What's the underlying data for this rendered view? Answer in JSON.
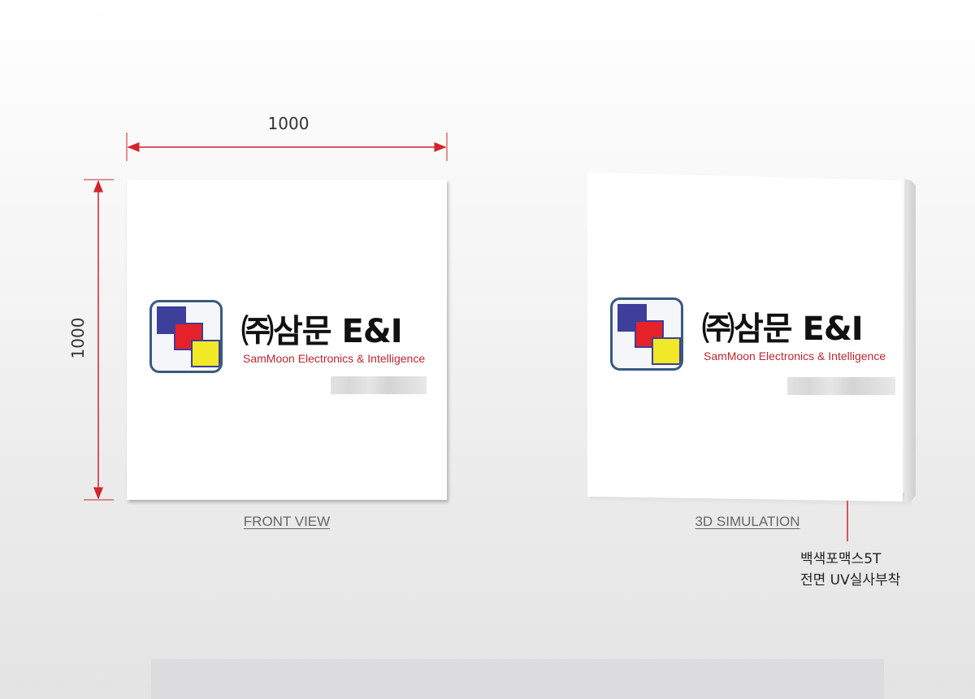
{
  "dimensions": {
    "width_label": "1000",
    "height_label": "1000"
  },
  "logo": {
    "title": "㈜삼문 E&I",
    "subtitle": "SamMoon Electronics & Intelligence"
  },
  "views": {
    "front_label": "FRONT VIEW",
    "sim_label": "3D SIMULATION"
  },
  "material_note": {
    "line1": "백색포맥스5T",
    "line2": "전면 UV실사부착"
  },
  "colors": {
    "dimension_line": "#d3242b",
    "icon_border": "#3a5a80",
    "blue_square": "#3d3f9a",
    "red_square": "#e5222a",
    "yellow_square": "#f1e828",
    "subtitle": "#c0262e"
  }
}
